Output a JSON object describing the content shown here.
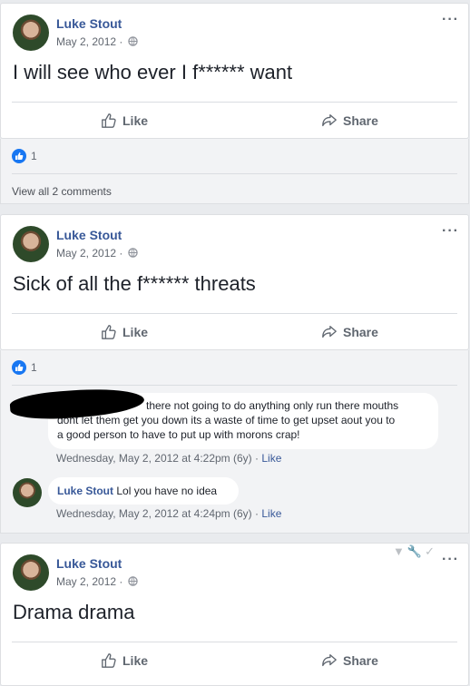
{
  "posts": [
    {
      "author": "Luke Stout",
      "date": "May 2, 2012 ·",
      "text": "I will see who ever I f****** want",
      "like_label": "Like",
      "share_label": "Share",
      "reaction_count": "1",
      "view_comments": "View all 2 comments"
    },
    {
      "author": "Luke Stout",
      "date": "May 2, 2012 ·",
      "text": "Sick of all the f****** threats",
      "like_label": "Like",
      "share_label": "Share",
      "reaction_count": "1",
      "comments": [
        {
          "author": "",
          "text_line1": "there not going to do anything only run there mouths",
          "text_line2": "dont let them get you down its a waste of time to get upset aout you to",
          "text_line3": "a good person to have to put up with morons crap!",
          "timestamp": "Wednesday, May 2, 2012 at 4:22pm (6y) ·",
          "like_label": "Like"
        },
        {
          "author": "Luke Stout",
          "text": "Lol you have no idea",
          "timestamp": "Wednesday, May 2, 2012 at 4:24pm (6y) ·",
          "like_label": "Like"
        }
      ]
    },
    {
      "author": "Luke Stout",
      "date": "May 2, 2012 ·",
      "text": "Drama drama",
      "like_label": "Like",
      "share_label": "Share"
    }
  ],
  "more_label": "···",
  "colors": {
    "link": "#385898",
    "like_blue": "#1877f2",
    "background": "#e9ebee"
  }
}
